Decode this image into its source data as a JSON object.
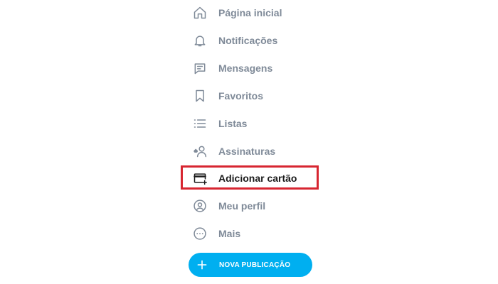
{
  "sidebar": {
    "items": [
      {
        "label": "Página inicial",
        "icon": "home-icon"
      },
      {
        "label": "Notificações",
        "icon": "bell-icon"
      },
      {
        "label": "Mensagens",
        "icon": "message-icon"
      },
      {
        "label": "Favoritos",
        "icon": "bookmark-icon"
      },
      {
        "label": "Listas",
        "icon": "list-icon"
      },
      {
        "label": "Assinaturas",
        "icon": "subscriptions-icon"
      },
      {
        "label": "Adicionar cartão",
        "icon": "add-card-icon",
        "active": true,
        "highlighted": true
      },
      {
        "label": "Meu perfil",
        "icon": "profile-icon"
      },
      {
        "label": "Mais",
        "icon": "more-icon"
      }
    ],
    "new_post_label": "NOVA PUBLICAÇÃO"
  },
  "colors": {
    "text_muted": "#7f8a98",
    "text_active": "#1a1a1a",
    "highlight": "#d72631",
    "accent": "#00aff0"
  }
}
